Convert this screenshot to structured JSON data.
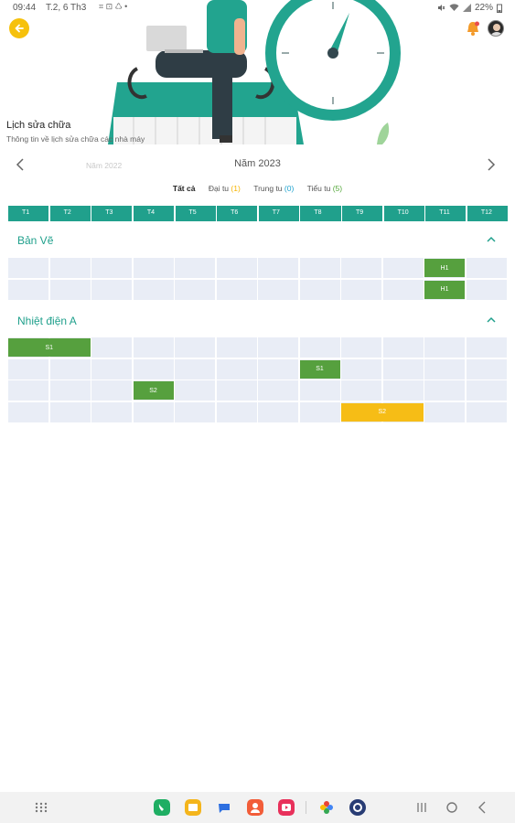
{
  "status_bar": {
    "time": "09:44",
    "date": "T.2, 6 Th3",
    "notifications": "⌗ ⊡ ♺ •",
    "battery": "22%"
  },
  "header": {
    "title": "Lịch sửa chữa",
    "subtitle": "Thông tin về lịch sửa chữa các nhà máy"
  },
  "year_nav": {
    "prev_year": "Năm 2022",
    "current_year": "Năm 2023"
  },
  "filters": {
    "all": "Tất cả",
    "major_label": "Đại tu",
    "major_count": "(1)",
    "mid_label": "Trung tu",
    "mid_count": "(0)",
    "minor_label": "Tiểu tu",
    "minor_count": "(5)"
  },
  "months": [
    "T1",
    "T2",
    "T3",
    "T4",
    "T5",
    "T6",
    "T7",
    "T8",
    "T9",
    "T10",
    "T11",
    "T12"
  ],
  "sections": [
    {
      "name": "Bản Vẽ",
      "rows": [
        {
          "bars": [
            {
              "label": "H1",
              "start": 11,
              "span": 1,
              "kind": "minor"
            }
          ]
        },
        {
          "bars": [
            {
              "label": "H1",
              "start": 11,
              "span": 1,
              "kind": "minor"
            }
          ]
        }
      ]
    },
    {
      "name": "Nhiệt điện A",
      "rows": [
        {
          "bars": [
            {
              "label": "S1",
              "start": 1,
              "span": 2,
              "kind": "minor"
            }
          ]
        },
        {
          "bars": [
            {
              "label": "S1",
              "start": 8,
              "span": 1,
              "kind": "minor"
            }
          ]
        },
        {
          "bars": [
            {
              "label": "S2",
              "start": 4,
              "span": 1,
              "kind": "minor"
            }
          ]
        },
        {
          "bars": [
            {
              "label": "S2",
              "start": 9,
              "span": 2,
              "kind": "major"
            }
          ]
        }
      ]
    }
  ],
  "colors": {
    "accent": "#20a08c",
    "minor": "#56a03e",
    "major": "#f6bd16",
    "mid": "#1fa3cf",
    "cell": "#e9edf6"
  }
}
